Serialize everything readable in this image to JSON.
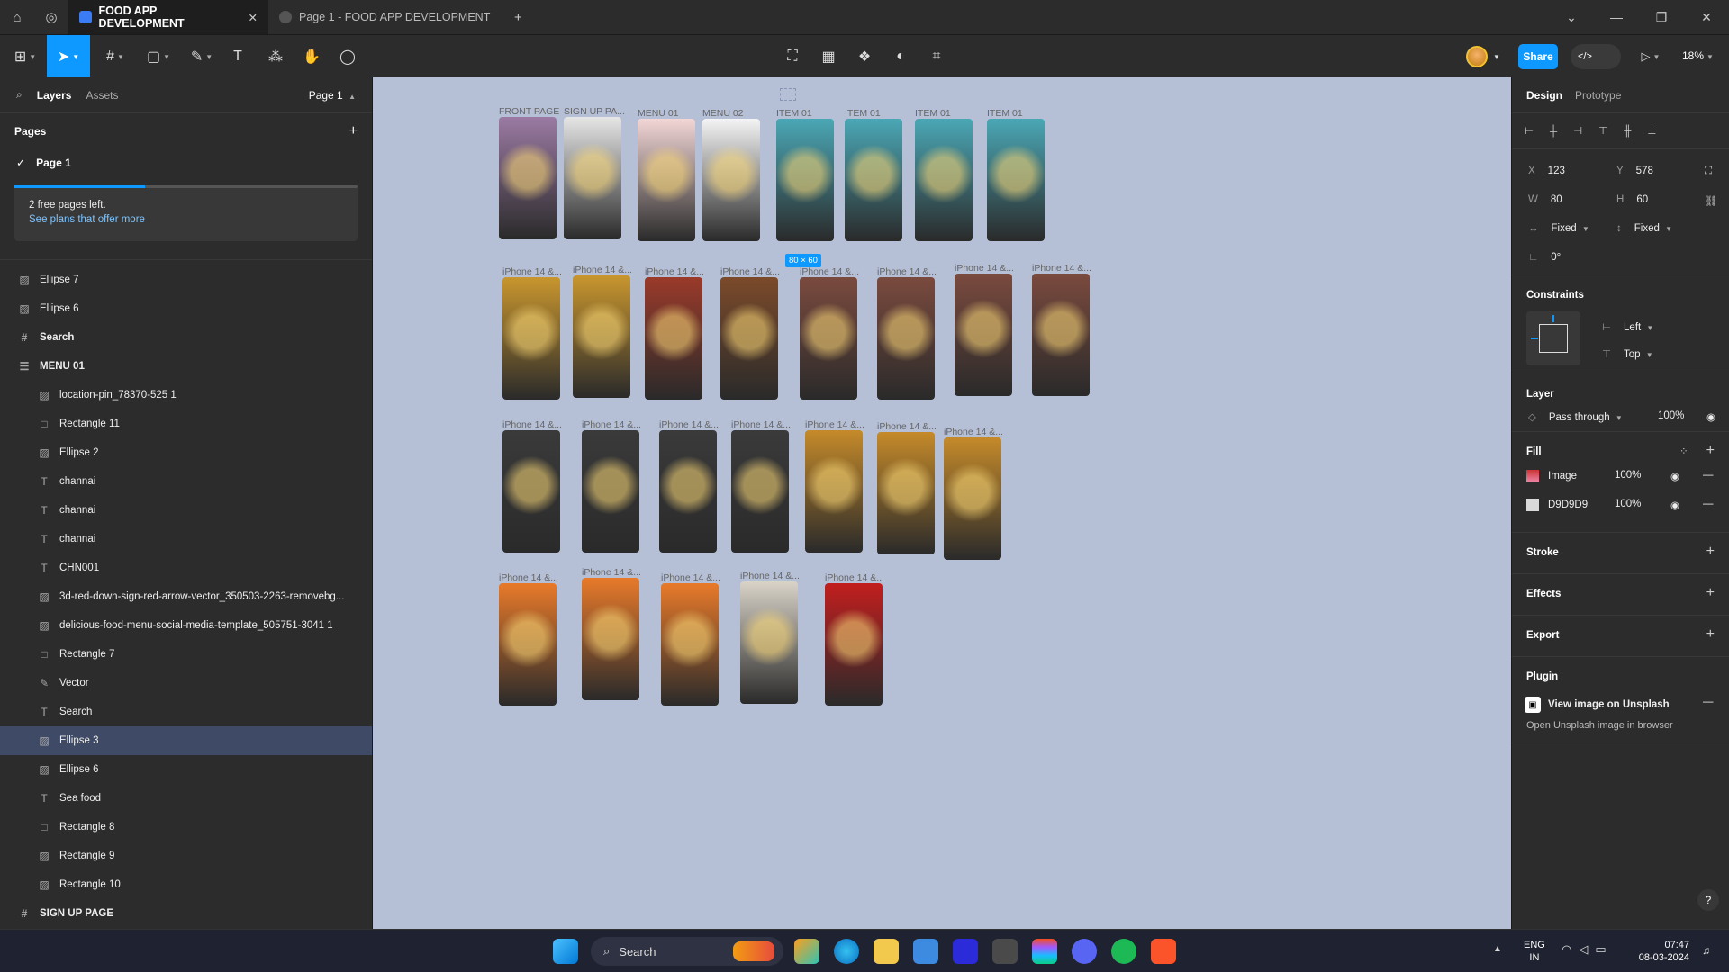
{
  "titlebar": {
    "home_icon": "home-icon",
    "globe_icon": "globe-icon",
    "tabs": [
      {
        "label": "FOOD APP DEVELOPMENT",
        "active": true
      },
      {
        "label": "Page 1 - FOOD APP DEVELOPMENT",
        "active": false
      }
    ],
    "new_tab": "+",
    "controls": [
      "⌄",
      "—",
      "❐",
      "✕"
    ]
  },
  "toolbar": {
    "share_label": "Share",
    "zoom": "18%",
    "devmode_label": "</>"
  },
  "left_panel": {
    "tabs": [
      "Layers",
      "Assets"
    ],
    "page_selector": "Page 1",
    "pages_title": "Pages",
    "add": "+",
    "pages": [
      "Page 1"
    ],
    "banner": {
      "line1": "2 free pages left.",
      "line2": "See plans that offer more"
    },
    "layers": [
      {
        "name": "Ellipse 7",
        "icon": "image-icon",
        "level": 0
      },
      {
        "name": "Ellipse 6",
        "icon": "image-icon",
        "level": 0
      },
      {
        "name": "Search",
        "icon": "frame-icon",
        "level": 0,
        "bold": true
      },
      {
        "name": "MENU 01",
        "icon": "list-icon",
        "level": 0,
        "bold": true
      },
      {
        "name": "location-pin_78370-525 1",
        "icon": "image-icon",
        "level": 1
      },
      {
        "name": "Rectangle 11",
        "icon": "rect-icon",
        "level": 1
      },
      {
        "name": "Ellipse 2",
        "icon": "image-icon",
        "level": 1
      },
      {
        "name": "channai",
        "icon": "text-icon",
        "level": 1
      },
      {
        "name": "channai",
        "icon": "text-icon",
        "level": 1
      },
      {
        "name": "channai",
        "icon": "text-icon",
        "level": 1
      },
      {
        "name": "CHN001",
        "icon": "text-icon",
        "level": 1
      },
      {
        "name": "3d-red-down-sign-red-arrow-vector_350503-2263-removebg...",
        "icon": "image-icon",
        "level": 1
      },
      {
        "name": "delicious-food-menu-social-media-template_505751-3041 1",
        "icon": "image-icon",
        "level": 1
      },
      {
        "name": "Rectangle 7",
        "icon": "rect-icon",
        "level": 1
      },
      {
        "name": "Vector",
        "icon": "vector-icon",
        "level": 1
      },
      {
        "name": "Search",
        "icon": "text-icon",
        "level": 1
      },
      {
        "name": "Ellipse 3",
        "icon": "image-icon",
        "level": 1,
        "selected": true
      },
      {
        "name": "Ellipse 6",
        "icon": "image-icon",
        "level": 1
      },
      {
        "name": "Sea food",
        "icon": "text-icon",
        "level": 1
      },
      {
        "name": "Rectangle 8",
        "icon": "rect-icon",
        "level": 1
      },
      {
        "name": "Rectangle 9",
        "icon": "image-icon",
        "level": 1
      },
      {
        "name": "Rectangle 10",
        "icon": "image-icon",
        "level": 1
      },
      {
        "name": "SIGN UP PAGE",
        "icon": "frame-icon",
        "level": 0,
        "bold": true
      }
    ]
  },
  "canvas": {
    "selection_badge": "80 × 60",
    "frames": [
      {
        "label": "FRONT PAGE",
        "color": "#9b7aa3"
      },
      {
        "label": "SIGN UP PA...",
        "color": "#e6e6e6"
      },
      {
        "label": "MENU 01",
        "color": "#f3d6d6"
      },
      {
        "label": "MENU 02",
        "color": "#f4f4f4"
      },
      {
        "label": "ITEM 01",
        "color": "#4aa7b5"
      },
      {
        "label": "ITEM 01",
        "color": "#4aa7b5"
      },
      {
        "label": "ITEM 01",
        "color": "#4aa7b5"
      },
      {
        "label": "ITEM 01",
        "color": "#4aa7b5"
      },
      {
        "label": "iPhone 14 &...",
        "color": "#c9962e"
      },
      {
        "label": "iPhone 14 &...",
        "color": "#c9962e"
      },
      {
        "label": "iPhone 14 &...",
        "color": "#9a3a2a"
      },
      {
        "label": "iPhone 14 &...",
        "color": "#7b4a2a"
      },
      {
        "label": "iPhone 14 &...",
        "color": "#7a4a3e"
      },
      {
        "label": "iPhone 14 &...",
        "color": "#7a4a3e"
      },
      {
        "label": "iPhone 14 &...",
        "color": "#7a4a3e"
      },
      {
        "label": "iPhone 14 &...",
        "color": "#7a4a3e"
      },
      {
        "label": "iPhone 14 &...",
        "color": "#3a3a3a"
      },
      {
        "label": "iPhone 14 &...",
        "color": "#3a3a3a"
      },
      {
        "label": "iPhone 14 &...",
        "color": "#3a3a3a"
      },
      {
        "label": "iPhone 14 &...",
        "color": "#3a3a3a"
      },
      {
        "label": "iPhone 14 &...",
        "color": "#c58a2a"
      },
      {
        "label": "iPhone 14 &...",
        "color": "#c58a2a"
      },
      {
        "label": "iPhone 14 &...",
        "color": "#c58a2a"
      },
      {
        "label": "iPhone 14 &...",
        "color": "#e87a2a"
      },
      {
        "label": "iPhone 14 &...",
        "color": "#e87a2a"
      },
      {
        "label": "iPhone 14 &...",
        "color": "#e87a2a"
      },
      {
        "label": "iPhone 14 &...",
        "color": "#d9d3c8"
      },
      {
        "label": "iPhone 14 &...",
        "color": "#c21e1e"
      }
    ]
  },
  "right_panel": {
    "tabs": [
      "Design",
      "Prototype"
    ],
    "x": "123",
    "y": "578",
    "w": "80",
    "h": "60",
    "x_label": "X",
    "y_label": "Y",
    "w_label": "W",
    "h_label": "H",
    "hsize": "Fixed",
    "vsize": "Fixed",
    "rotation": "0°",
    "constraints_title": "Constraints",
    "c_h": "Left",
    "c_v": "Top",
    "layer_title": "Layer",
    "blend": "Pass through",
    "opacity": "100%",
    "fill_title": "Fill",
    "fills": [
      {
        "name": "Image",
        "opacity": "100%"
      },
      {
        "name": "D9D9D9",
        "opacity": "100%"
      }
    ],
    "stroke_title": "Stroke",
    "effects_title": "Effects",
    "export_title": "Export",
    "plugin_title": "Plugin",
    "plugin_name": "View image on Unsplash",
    "plugin_desc": "Open Unsplash image in browser",
    "help": "?"
  },
  "taskbar": {
    "search_label": "Search",
    "lang1": "ENG",
    "lang2": "IN",
    "time": "07:47",
    "date": "08-03-2024"
  }
}
